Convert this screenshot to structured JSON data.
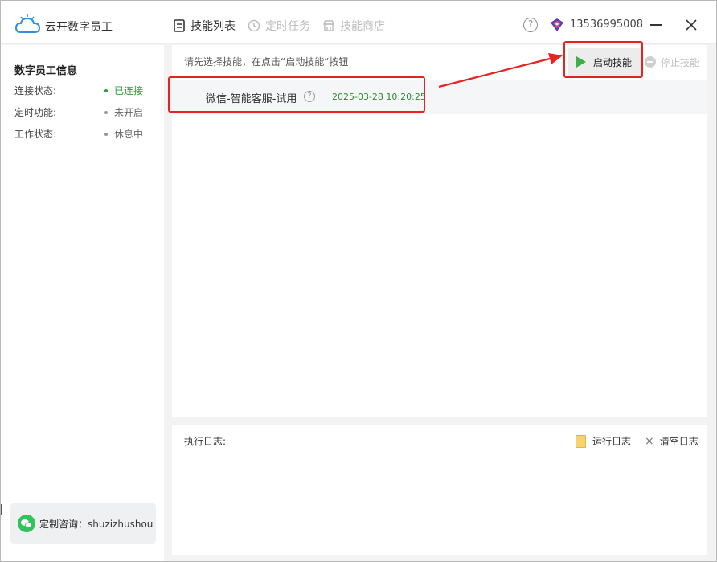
{
  "app": {
    "title": "云开数字员工",
    "user_phone": "13536995008",
    "help": "?"
  },
  "nav": {
    "skill_list": "技能列表",
    "scheduled_tasks": "定时任务",
    "skill_store": "技能商店"
  },
  "sidebar": {
    "title": "数字员工信息",
    "rows": [
      {
        "label": "连接状态:",
        "value": "已连接",
        "color": "#2e9b37"
      },
      {
        "label": "定时功能:",
        "value": "未开启",
        "color": "#666666"
      },
      {
        "label": "工作状态:",
        "value": "休息中",
        "color": "#666666"
      }
    ],
    "consult": "定制咨询：shuzizhushou"
  },
  "skills": {
    "hint": "请先选择技能，在点击“启动技能”按钮",
    "start_label": "启动技能",
    "stop_label": "停止技能",
    "items": [
      {
        "name": "微信-智能客服-试用",
        "date": "2025-03-28 10:20:25"
      }
    ]
  },
  "log": {
    "title": "执行日志:",
    "run_log": "运行日志",
    "clear_log": "清空日志"
  },
  "colors": {
    "accent_green": "#3fae49",
    "highlight_red": "#e8231f",
    "brand_blue": "#2f8fe0"
  }
}
